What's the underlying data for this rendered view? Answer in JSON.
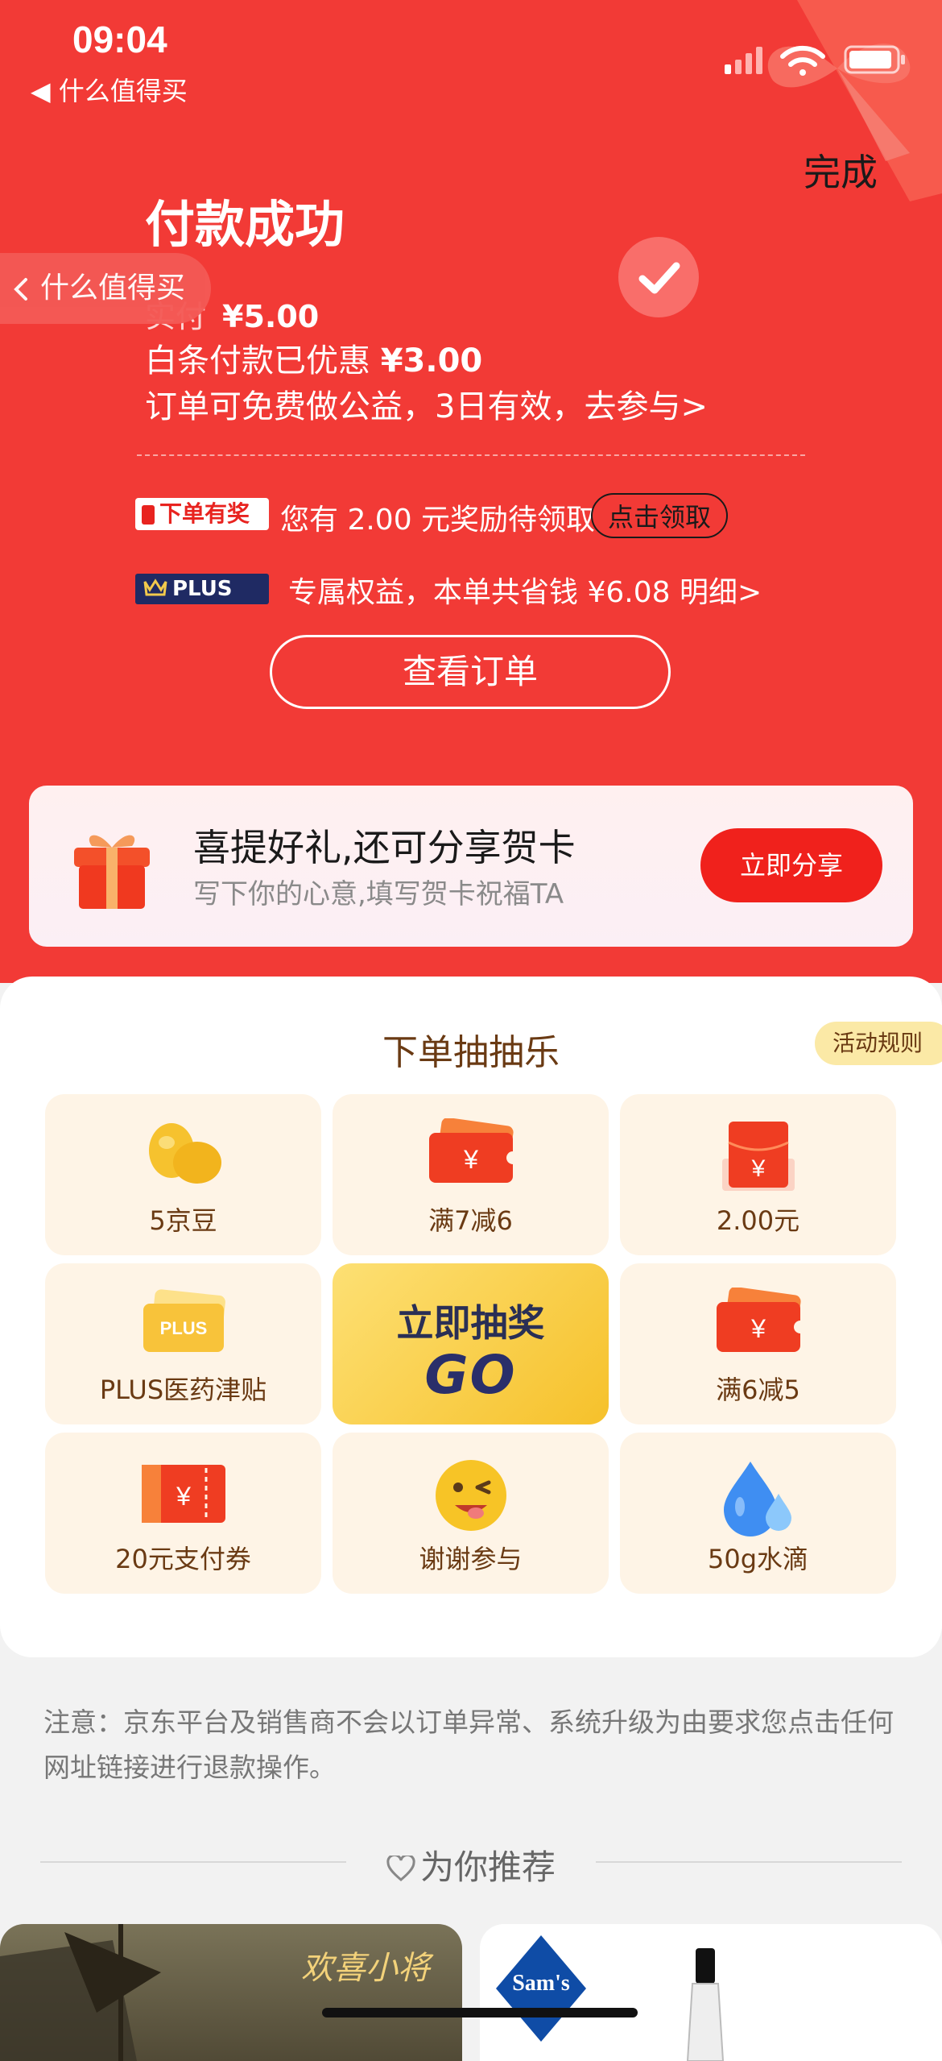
{
  "status_bar": {
    "time": "09:04",
    "back_app": "◀ 什么值得买"
  },
  "header": {
    "done_label": "完成",
    "title": "付款成功",
    "float_back_label": "什么值得买"
  },
  "payment": {
    "paid_label": "实付",
    "paid_amount": "¥5.00",
    "discount_label": "白条付款已优惠",
    "discount_amount": "¥3.00",
    "charity_text": "订单可免费做公益，3日有效，去参与>"
  },
  "reward": {
    "tag": "下单有奖",
    "text": "您有 2.00 元奖励待领取",
    "button": "点击领取"
  },
  "plus": {
    "tag": "PLUS",
    "text": "专属权益，本单共省钱 ¥6.08 明细>"
  },
  "view_order_button": "查看订单",
  "share_card": {
    "title": "喜提好礼,还可分享贺卡",
    "subtitle": "写下你的心意,填写贺卡祝福TA",
    "button": "立即分享"
  },
  "lottery": {
    "title": "下单抽抽乐",
    "rules_button": "活动规则",
    "go_title": "立即抽奖",
    "go_big": "GO",
    "prizes": [
      {
        "label": "5京豆",
        "icon": "jingdou-beans-icon"
      },
      {
        "label": "满7减6",
        "icon": "coupon-yen-icon"
      },
      {
        "label": "2.00元",
        "icon": "red-envelope-icon"
      },
      {
        "label": "PLUS医药津贴",
        "icon": "plus-card-icon"
      },
      {
        "label": "满6减5",
        "icon": "coupon-yen-icon"
      },
      {
        "label": "20元支付券",
        "icon": "payment-ticket-icon"
      },
      {
        "label": "谢谢参与",
        "icon": "wink-emoji-icon"
      },
      {
        "label": "50g水滴",
        "icon": "water-drop-icon"
      }
    ]
  },
  "notice": "注意：京东平台及销售商不会以订单异常、系统升级为由要求您点击任何网址链接进行退款操作。",
  "recommend_title": "为你推荐",
  "recommend_cards": [
    {
      "label": "欢喜小将"
    },
    {
      "label": "Sam's"
    }
  ]
}
